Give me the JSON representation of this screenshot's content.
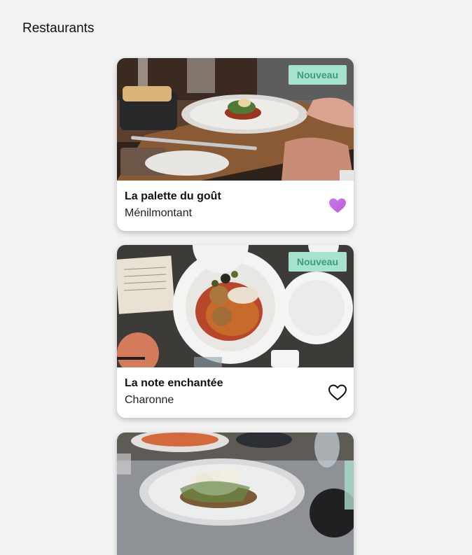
{
  "header": {
    "title": "Restaurants"
  },
  "restaurants": [
    {
      "name": "La palette du goût",
      "district": "Ménilmontant",
      "badge": "Nouveau",
      "favorite": true
    },
    {
      "name": "La note enchantée",
      "district": "Charonne",
      "badge": "Nouveau",
      "favorite": false
    },
    {
      "name": "",
      "district": "",
      "badge": "",
      "favorite": false
    }
  ],
  "colors": {
    "badge_bg": "#a6e3cc",
    "badge_text": "#3c9c79",
    "favorite_active": "#c974e0",
    "favorite_inactive": "#111111"
  },
  "icons": {
    "favorite": "heart-icon"
  }
}
